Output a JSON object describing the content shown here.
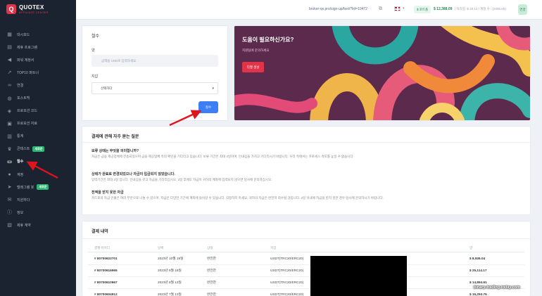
{
  "brand": {
    "title": "QUOTEX",
    "subtitle": "AFFILIATE CENTER"
  },
  "sidebar": {
    "items": [
      {
        "label": "대시보드",
        "icon": "grid-icon"
      },
      {
        "label": "제휴 프로그램",
        "icon": "program-icon"
      },
      {
        "label": "파워 계정서",
        "icon": "megaphone-icon"
      },
      {
        "label": "TOP10 파트너",
        "icon": "trending-icon"
      },
      {
        "label": "연결",
        "icon": "link-icon"
      },
      {
        "label": "포스트백",
        "icon": "globe-icon"
      },
      {
        "label": "프로모션 코드",
        "icon": "tag-icon"
      },
      {
        "label": "프로모션 자료",
        "icon": "image-icon"
      },
      {
        "label": "통계",
        "icon": "chart-icon"
      },
      {
        "label": "콘테스트",
        "icon": "trophy-icon",
        "badge": "새로운"
      },
      {
        "label": "철수",
        "icon": "wallet-icon",
        "active": true
      },
      {
        "label": "계정",
        "icon": "user-icon"
      },
      {
        "label": "텔레그램 봇",
        "icon": "telegram-icon",
        "badge": "새로운"
      },
      {
        "label": "지원하다",
        "icon": "support-icon"
      },
      {
        "label": "정보",
        "icon": "info-icon"
      },
      {
        "label": "제휴 계약",
        "icon": "contract-icon"
      }
    ]
  },
  "topbar": {
    "referral_url": "broker-qx.pro/sign-up/fast/?lid=10472",
    "status": "$ 포트폴",
    "balance": "$ 12,388.09",
    "balance_detail": "| 처리중: $ 18.12 / 계정 수 : (2095.65)",
    "action": "연결"
  },
  "withdraw": {
    "title": "철수",
    "amount_label": "양",
    "amount_placeholder": "금액을 USD로 입력하세요.",
    "method_label": "지갑",
    "method_value": "선택하다",
    "submit": "철수"
  },
  "help": {
    "title": "도움이 필요하신가요?",
    "subtitle": "지원팀에 문의하세요",
    "button": "티켓 생성"
  },
  "faq": {
    "title": "결제에 관해 자주 묻는 질문",
    "items": [
      {
        "q": "보류 상태는 무엇을 의미합니까?",
        "a": "자금은 금융 제공업체에 전송되었으며 금융 제공업체 측의 확인을 기다리고 있습니다. 보류 기간은 최대 3일이며, 인내심을 가지고 기다리시기 바랍니다. 우리 측에서는 프로세스 속도를 높일 수 없습니다."
      },
      {
        "q": "상태가 완료로 변경되었으나 자금이 입금되지 않았습니다.",
        "a": "입력기간은 최대 3일 입니다. 인내심을 갖고 자금을 기다리십시오. 3일 후에도 자금이 귀하의 계좌에 입력되지 않으면 당사에 문의하십시오."
      },
      {
        "q": "전액을 받지 못한 자금",
        "a": "커드로의 자금 인출은 여러 부분으로 나눌 수 있으며, 자금은 다양한 기간에 계좌에 들어갈 수 있습니다. 걱정하지 마세요, 귀하의 자금은 완전히 회수될 것입니다. 3일 이내에 자금을 받지 못한 경우 당사에 문의하시기 바랍니다."
      }
    ]
  },
  "history": {
    "title": "결제 내역",
    "columns": [
      "결제 아이디",
      "날짜",
      "상태",
      "지갑",
      "양"
    ],
    "rows": [
      {
        "id": "# 80700622701",
        "date": "2023년 10월 19일",
        "status": "완전한",
        "wallet": "USDT(TRC20/ERC20)",
        "amount": "$ 8,936.04"
      },
      {
        "id": "# 80700616965",
        "date": "2023년 9월 18일",
        "status": "완전한",
        "wallet": "USDT(TRC20/ERC20)",
        "amount": "$ 25,114.17"
      },
      {
        "id": "# 80700610967",
        "date": "2023년 8월 13일",
        "status": "완전한",
        "wallet": "USDT(TRC20/ERC20)",
        "amount": "$ 14,894.61"
      },
      {
        "id": "# 80700604912",
        "date": "2023년 7월 13일",
        "status": "완전한",
        "wallet": "USDT(TRC20/ERC20)",
        "amount": "$ 15,293.76"
      }
    ]
  },
  "watermark": "binary-trading-today.com"
}
